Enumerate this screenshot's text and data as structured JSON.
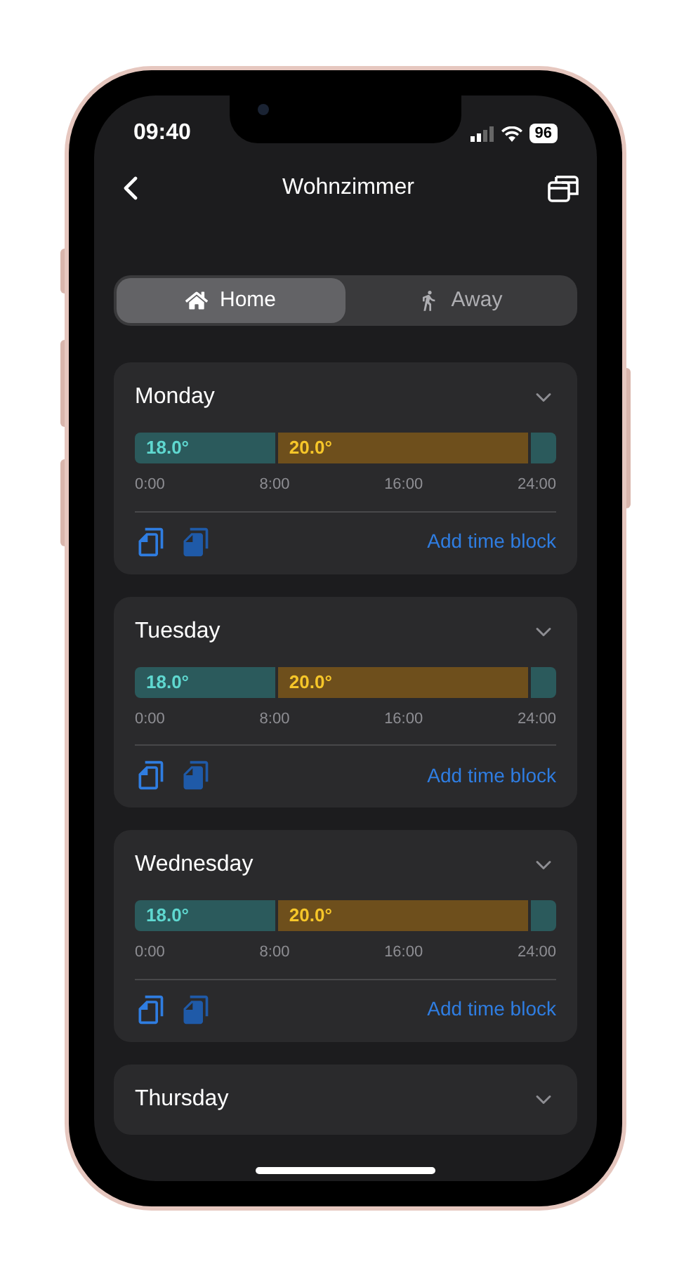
{
  "status_bar": {
    "time": "09:40",
    "battery": "96"
  },
  "nav": {
    "title": "Wohnzimmer"
  },
  "mode_tabs": [
    {
      "label": "Home",
      "selected": true
    },
    {
      "label": "Away",
      "selected": false
    }
  ],
  "days": [
    {
      "name": "Monday",
      "segments": [
        {
          "kind": "low",
          "label": "18.0°",
          "level": 0.333
        },
        {
          "kind": "high",
          "label": "20.0°"
        },
        {
          "kind": "low",
          "level": 0.067
        }
      ],
      "ticks": [
        "0:00",
        "8:00",
        "16:00",
        "24:00"
      ],
      "add_label": "Add time block"
    },
    {
      "name": "Tuesday",
      "segments": [
        {
          "kind": "low",
          "label": "18.0°",
          "level": 0.333
        },
        {
          "kind": "high",
          "label": "20.0°"
        },
        {
          "kind": "low",
          "level": 0.067
        }
      ],
      "ticks": [
        "0:00",
        "8:00",
        "16:00",
        "24:00"
      ],
      "add_label": "Add time block"
    },
    {
      "name": "Wednesday",
      "segments": [
        {
          "kind": "low",
          "label": "18.0°",
          "level": 0.333
        },
        {
          "kind": "high",
          "label": "20.0°"
        },
        {
          "kind": "low",
          "level": 0.067
        }
      ],
      "ticks": [
        "0:00",
        "8:00",
        "16:00",
        "24:00"
      ],
      "add_label": "Add time block"
    },
    {
      "name": "Thursday"
    }
  ]
}
